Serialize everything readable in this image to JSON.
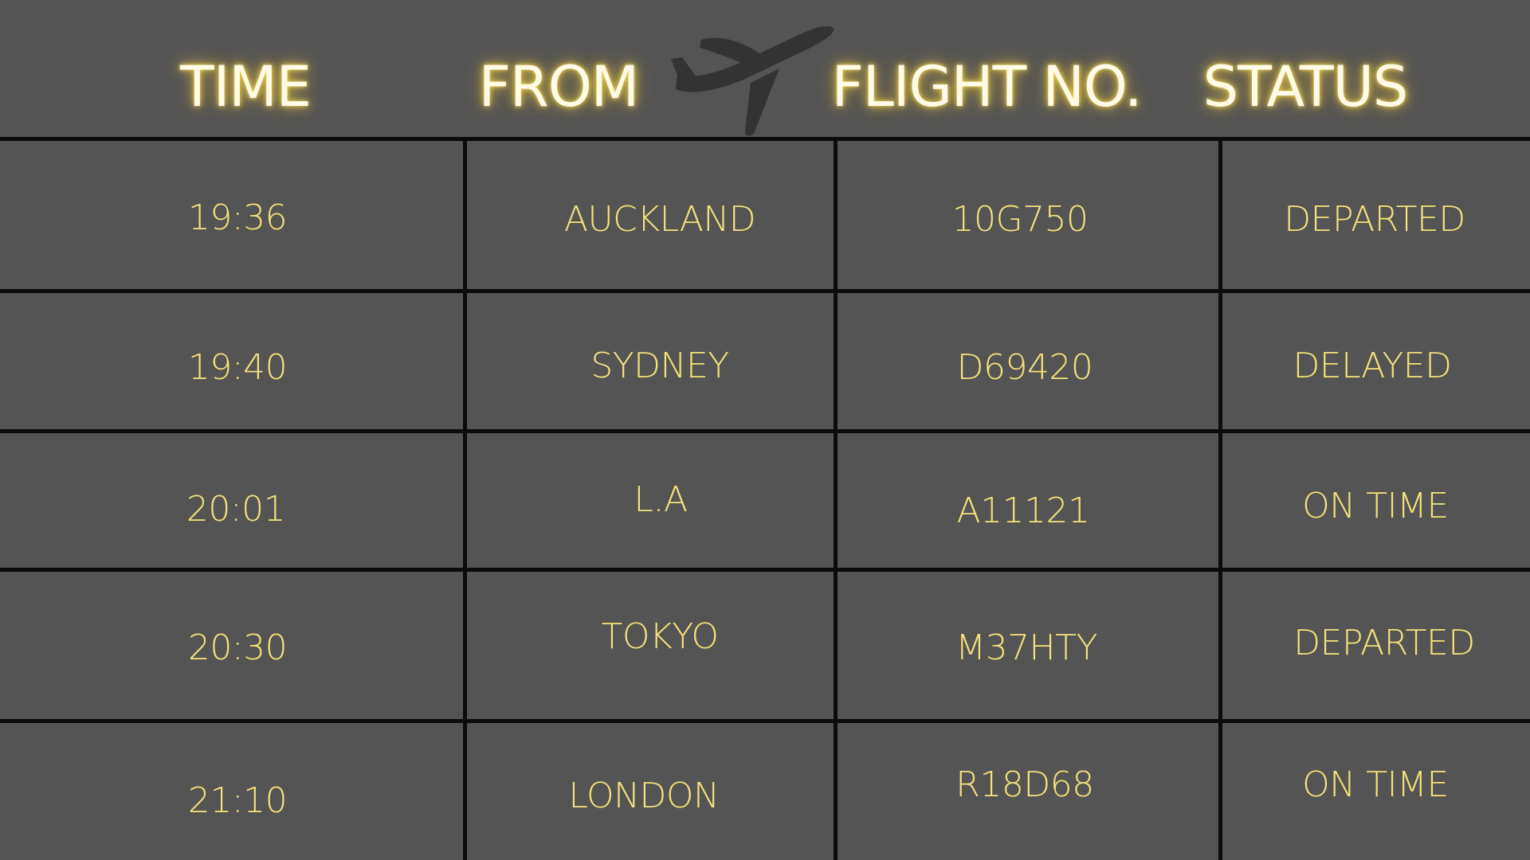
{
  "header": {
    "time": "TIME",
    "from": "FROM",
    "flight_no": "FLIGHT NO.",
    "status": "STATUS",
    "icon": "airplane-icon"
  },
  "flights": [
    {
      "time": "19:36",
      "from": "AUCKLAND",
      "flight_no": "10G750",
      "status": "DEPARTED"
    },
    {
      "time": "19:40",
      "from": "SYDNEY",
      "flight_no": "D69420",
      "status": "DELAYED"
    },
    {
      "time": "20:01",
      "from": "L.A",
      "flight_no": "A11121",
      "status": "ON TIME"
    },
    {
      "time": "20:30",
      "from": "TOKYO",
      "flight_no": "M37HTY",
      "status": "DEPARTED"
    },
    {
      "time": "21:10",
      "from": "LONDON",
      "flight_no": "R18D68",
      "status": "ON TIME"
    }
  ],
  "colors": {
    "background": "#545454",
    "grid_lines": "#0b0b0b",
    "header_text": "#fffbe6",
    "header_glow": "#ffd63c",
    "cell_text": "#f5e27a",
    "plane": "#333333"
  }
}
